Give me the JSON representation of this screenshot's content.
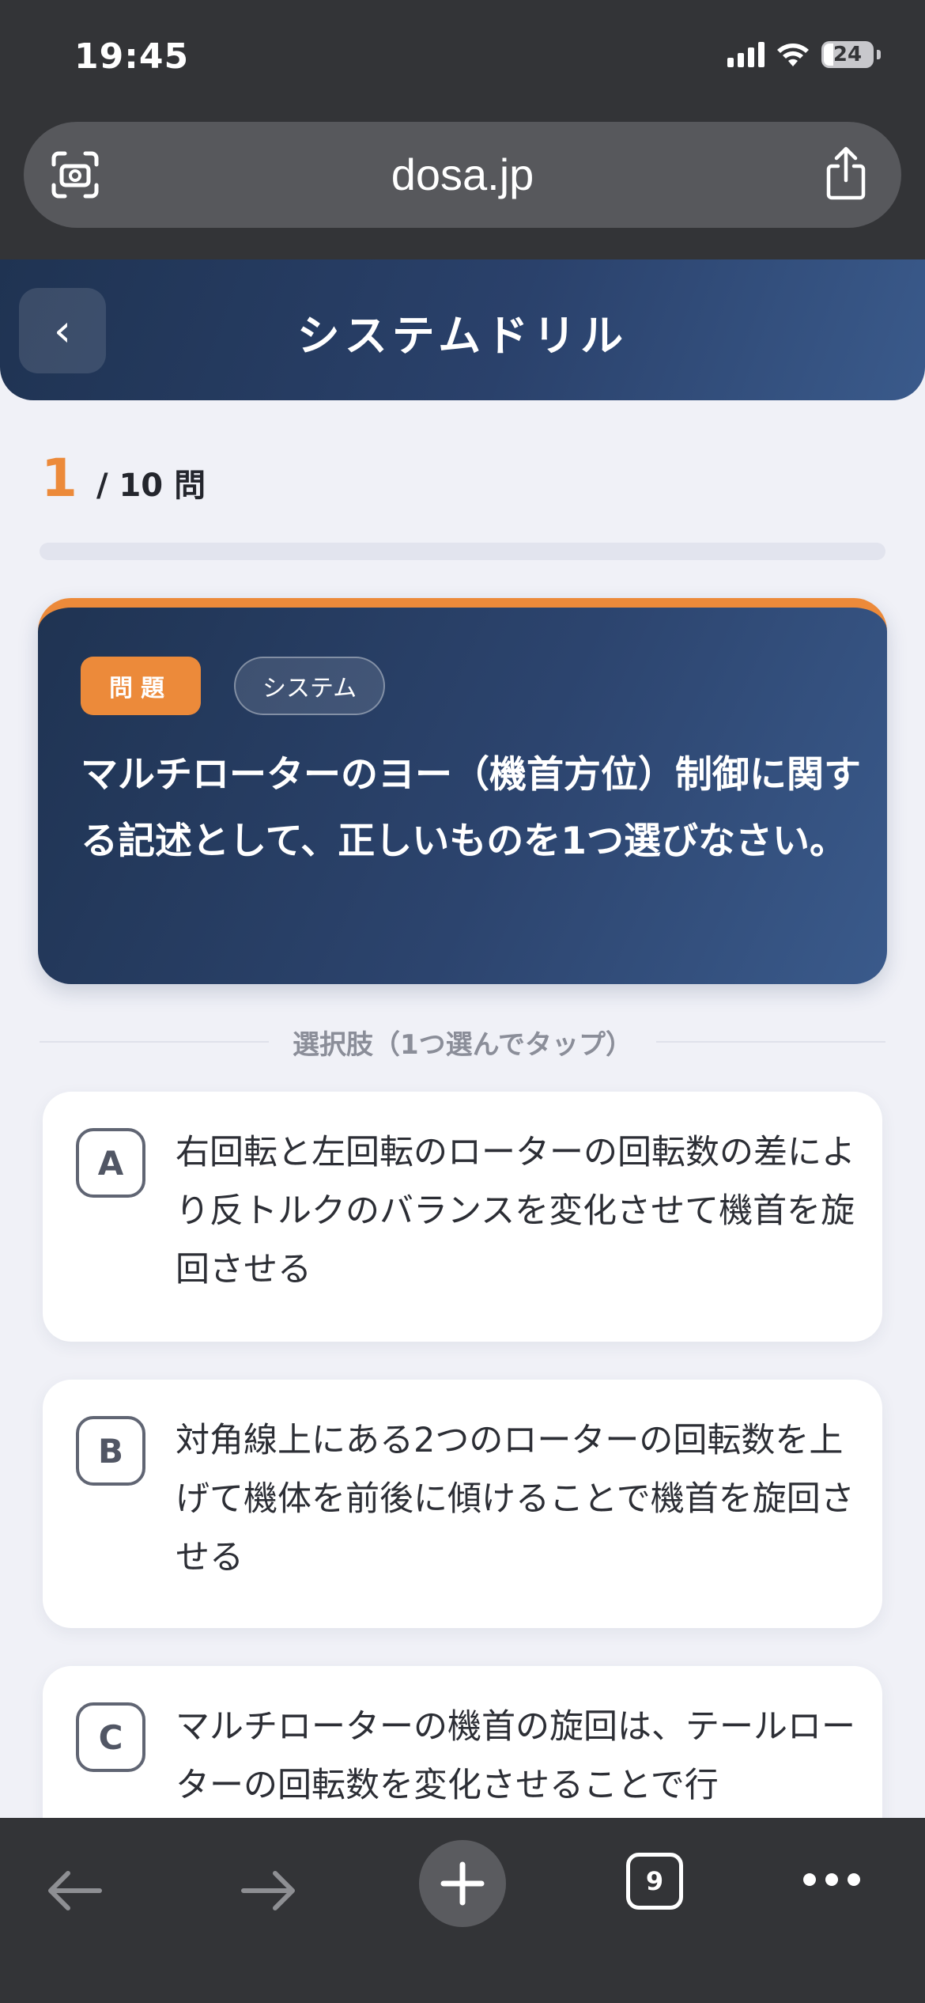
{
  "status_bar": {
    "time": "19:45",
    "battery": "24"
  },
  "browser": {
    "url": "dosa.jp",
    "open_tabs": "9"
  },
  "header": {
    "back_label": "‹",
    "title": "システムドリル"
  },
  "progress": {
    "current": "1",
    "total_label": "/ 10 問",
    "fraction": 0
  },
  "question": {
    "badge": "問題",
    "category": "システム",
    "text": "マルチローターのヨー（機首方位）制御に関する記述として、正しいものを1つ選びなさい。"
  },
  "choices_label": "選択肢（1つ選んでタップ）",
  "options": [
    {
      "letter": "A",
      "text": "右回転と左回転のローターの回転数の差により反トルクのバランスを変化させて機首を旋回させる"
    },
    {
      "letter": "B",
      "text": "対角線上にある2つのローターの回転数を上げて機体を前後に傾けることで機首を旋回させる"
    },
    {
      "letter": "C",
      "text": "マルチローターの機首の旋回は、テールローターの回転数を変化させることで行"
    }
  ],
  "colors": {
    "accent": "#ec8a3a",
    "header_navy": "#22375a",
    "browser_chrome": "#333437",
    "page_background": "#f0f1f7"
  }
}
